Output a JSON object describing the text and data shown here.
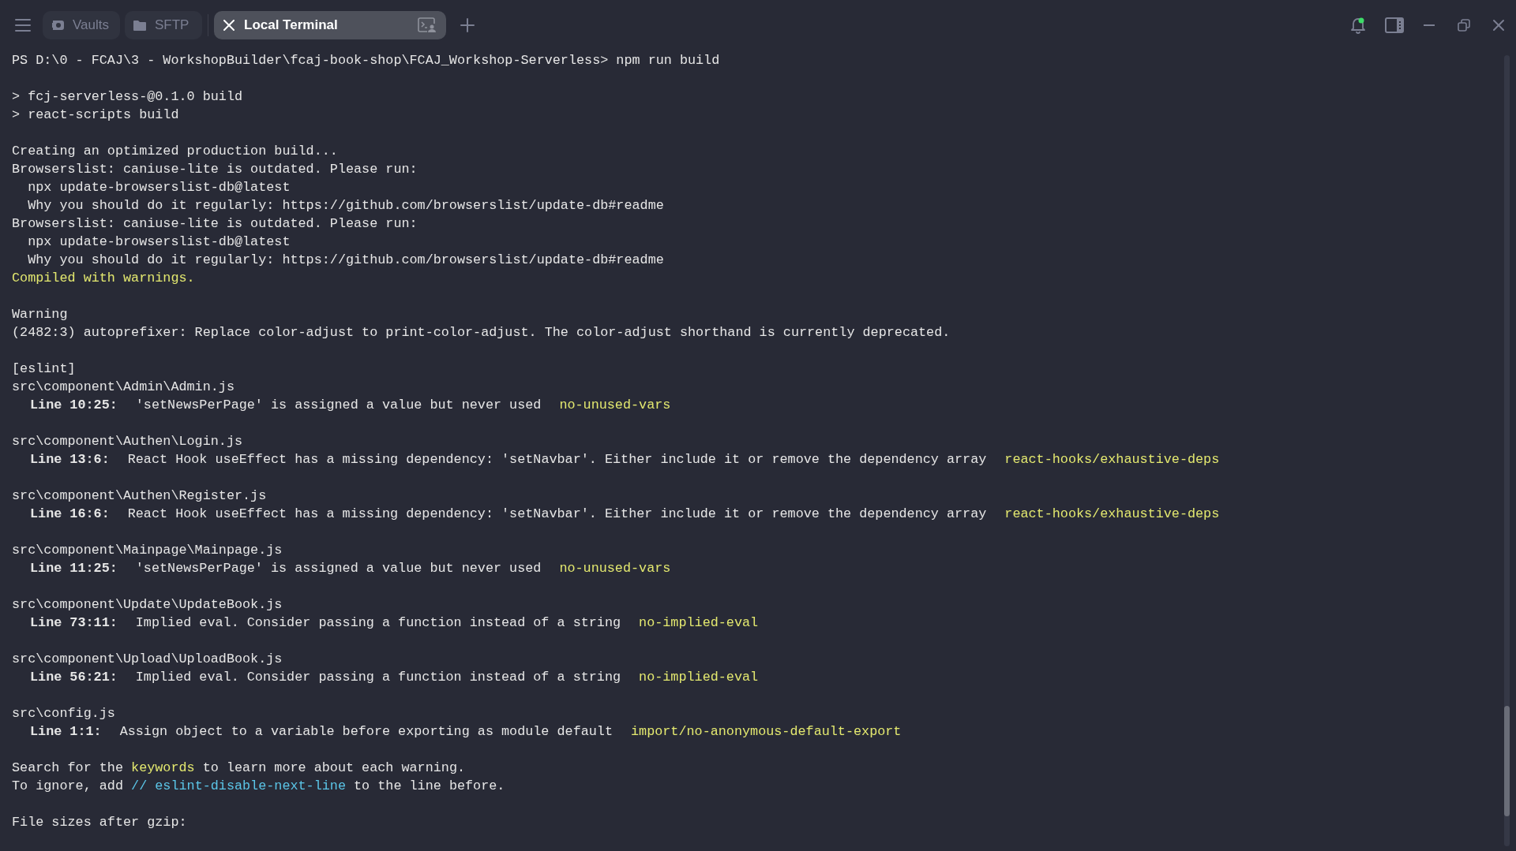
{
  "tabs": [
    {
      "label": "Vaults",
      "kind": "vaults",
      "selected": false
    },
    {
      "label": "SFTP",
      "kind": "sftp",
      "selected": false
    },
    {
      "label": "Local Terminal",
      "kind": "terminal",
      "selected": true
    }
  ],
  "notifications": {
    "unread": true
  },
  "terminal": {
    "blocks": [
      [
        {
          "kind": "text",
          "segments": [
            {
              "text": "PS D:\\0 - FCAJ\\3 - WorkshopBuilder\\fcaj-book-shop\\FCAJ_Workshop-Serverless> npm run build"
            }
          ]
        }
      ],
      [
        {
          "kind": "text",
          "segments": [
            {
              "text": "> fcj-serverless-@0.1.0 build"
            }
          ]
        },
        {
          "kind": "text",
          "segments": [
            {
              "text": "> react-scripts build"
            }
          ]
        }
      ],
      [
        {
          "kind": "text",
          "segments": [
            {
              "text": "Creating an optimized production build..."
            }
          ]
        },
        {
          "kind": "text",
          "segments": [
            {
              "text": "Browserslist: caniuse-lite is outdated. Please run:"
            }
          ]
        },
        {
          "kind": "text",
          "segments": [
            {
              "text": "  npx update-browserslist-db@latest"
            }
          ]
        },
        {
          "kind": "text",
          "segments": [
            {
              "text": "  Why you should do it regularly: https://github.com/browserslist/update-db#readme"
            }
          ]
        },
        {
          "kind": "text",
          "segments": [
            {
              "text": "Browserslist: caniuse-lite is outdated. Please run:"
            }
          ]
        },
        {
          "kind": "text",
          "segments": [
            {
              "text": "  npx update-browserslist-db@latest"
            }
          ]
        },
        {
          "kind": "text",
          "segments": [
            {
              "text": "  Why you should do it regularly: https://github.com/browserslist/update-db#readme"
            }
          ]
        },
        {
          "kind": "text",
          "segments": [
            {
              "text": "Compiled with warnings.",
              "color": "#e3e86f"
            }
          ]
        }
      ],
      [
        {
          "kind": "text",
          "segments": [
            {
              "text": "Warning"
            }
          ]
        },
        {
          "kind": "text",
          "segments": [
            {
              "text": "(2482:3) autoprefixer: Replace color-adjust to print-color-adjust. The color-adjust shorthand is currently deprecated."
            }
          ]
        }
      ],
      [
        {
          "kind": "text",
          "segments": [
            {
              "text": "[eslint]"
            }
          ]
        },
        {
          "kind": "text",
          "segments": [
            {
              "text": "src\\component\\Admin\\Admin.js"
            }
          ]
        },
        {
          "kind": "lint",
          "location": "Line 10:25:",
          "message": "'setNewsPerPage' is assigned a value but never used",
          "rule": "no-unused-vars"
        }
      ],
      [
        {
          "kind": "text",
          "segments": [
            {
              "text": "src\\component\\Authen\\Login.js"
            }
          ]
        },
        {
          "kind": "lint",
          "location": "Line 13:6:",
          "message": "React Hook useEffect has a missing dependency: 'setNavbar'. Either include it or remove the dependency array",
          "rule": "react-hooks/exhaustive-deps"
        }
      ],
      [
        {
          "kind": "text",
          "segments": [
            {
              "text": "src\\component\\Authen\\Register.js"
            }
          ]
        },
        {
          "kind": "lint",
          "location": "Line 16:6:",
          "message": "React Hook useEffect has a missing dependency: 'setNavbar'. Either include it or remove the dependency array",
          "rule": "react-hooks/exhaustive-deps"
        }
      ],
      [
        {
          "kind": "text",
          "segments": [
            {
              "text": "src\\component\\Mainpage\\Mainpage.js"
            }
          ]
        },
        {
          "kind": "lint",
          "location": "Line 11:25:",
          "message": "'setNewsPerPage' is assigned a value but never used",
          "rule": "no-unused-vars"
        }
      ],
      [
        {
          "kind": "text",
          "segments": [
            {
              "text": "src\\component\\Update\\UpdateBook.js"
            }
          ]
        },
        {
          "kind": "lint",
          "location": "Line 73:11:",
          "message": "Implied eval. Consider passing a function instead of a string",
          "rule": "no-implied-eval"
        }
      ],
      [
        {
          "kind": "text",
          "segments": [
            {
              "text": "src\\component\\Upload\\UploadBook.js"
            }
          ]
        },
        {
          "kind": "lint",
          "location": "Line 56:21:",
          "message": "Implied eval. Consider passing a function instead of a string",
          "rule": "no-implied-eval"
        }
      ],
      [
        {
          "kind": "text",
          "segments": [
            {
              "text": "src\\config.js"
            }
          ]
        },
        {
          "kind": "lint",
          "location": "Line 1:1:",
          "message": "Assign object to a variable before exporting as module default",
          "rule": "import/no-anonymous-default-export"
        }
      ],
      [
        {
          "kind": "text",
          "segments": [
            {
              "text": "Search for the "
            },
            {
              "text": "keywords",
              "color": "#e3e86f"
            },
            {
              "text": " to learn more about each warning."
            }
          ]
        },
        {
          "kind": "text",
          "segments": [
            {
              "text": "To ignore, add "
            },
            {
              "text": "// eslint-disable-next-line",
              "color": "#5bc6e8"
            },
            {
              "text": " to the line before."
            }
          ]
        }
      ],
      [
        {
          "kind": "text",
          "segments": [
            {
              "text": "File sizes after gzip:"
            }
          ]
        }
      ]
    ]
  }
}
